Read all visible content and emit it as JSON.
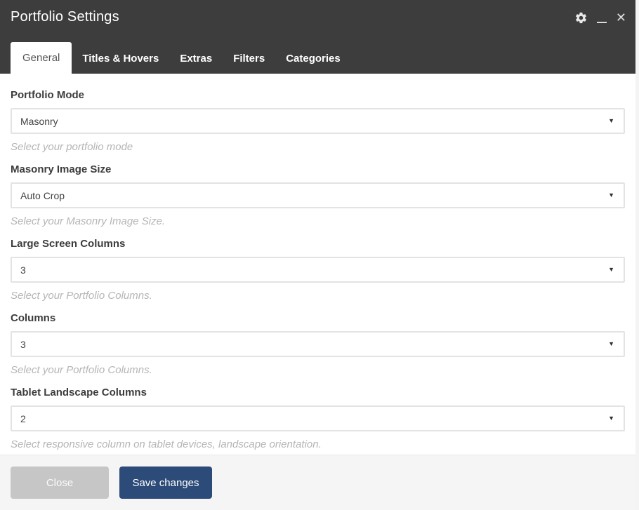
{
  "window": {
    "title": "Portfolio Settings"
  },
  "icons": {
    "settings": "gear",
    "minimize": "underscore-line",
    "close_glyph": "✕",
    "dropdown_glyph": "▼"
  },
  "tabs": [
    {
      "label": "General",
      "active": true
    },
    {
      "label": "Titles & Hovers",
      "active": false
    },
    {
      "label": "Extras",
      "active": false
    },
    {
      "label": "Filters",
      "active": false
    },
    {
      "label": "Categories",
      "active": false
    }
  ],
  "fields": [
    {
      "label": "Portfolio Mode",
      "value": "Masonry",
      "help": "Select your portfolio mode"
    },
    {
      "label": "Masonry Image Size",
      "value": "Auto Crop",
      "help": "Select your Masonry Image Size."
    },
    {
      "label": "Large Screen Columns",
      "value": "3",
      "help": "Select your Portfolio Columns."
    },
    {
      "label": "Columns",
      "value": "3",
      "help": "Select your Portfolio Columns."
    },
    {
      "label": "Tablet Landscape Columns",
      "value": "2",
      "help": "Select responsive column on tablet devices, landscape orientation."
    }
  ],
  "footer": {
    "close_label": "Close",
    "save_label": "Save changes"
  },
  "colors": {
    "header_bg": "#3d3d3d",
    "save_button": "#2d4b78",
    "close_button": "#c6c6c6",
    "footer_bg": "#f5f5f5",
    "select_border": "#e3e3e3",
    "help_text": "#b5b5b5"
  }
}
